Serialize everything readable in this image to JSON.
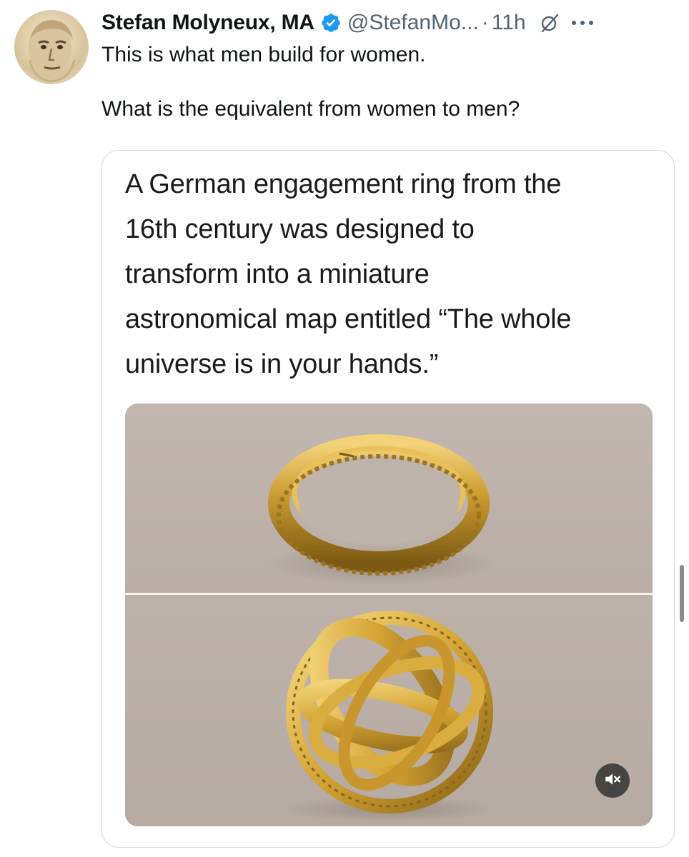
{
  "tweet": {
    "author": {
      "display_name": "Stefan Molyneux, MA",
      "handle": "@StefanMo...",
      "verified": true
    },
    "separator": "·",
    "timestamp": "11h",
    "text_lines": [
      "This is what men build for women.",
      "What is the equivalent from women to men?"
    ],
    "media": {
      "caption_lines": [
        "A German engagement ring from the",
        "16th century was designed to",
        "transform into a miniature",
        "astronomical map entitled “The whole",
        "universe is in your hands.”"
      ]
    }
  },
  "colors": {
    "verified": "#1d9bf0",
    "secondary_text": "#536471",
    "border": "#cfd9de"
  },
  "icons": {
    "verified": "verified-badge-icon",
    "grok": "grok-icon",
    "more": "more-options-icon",
    "mute": "speaker-muted-icon"
  }
}
